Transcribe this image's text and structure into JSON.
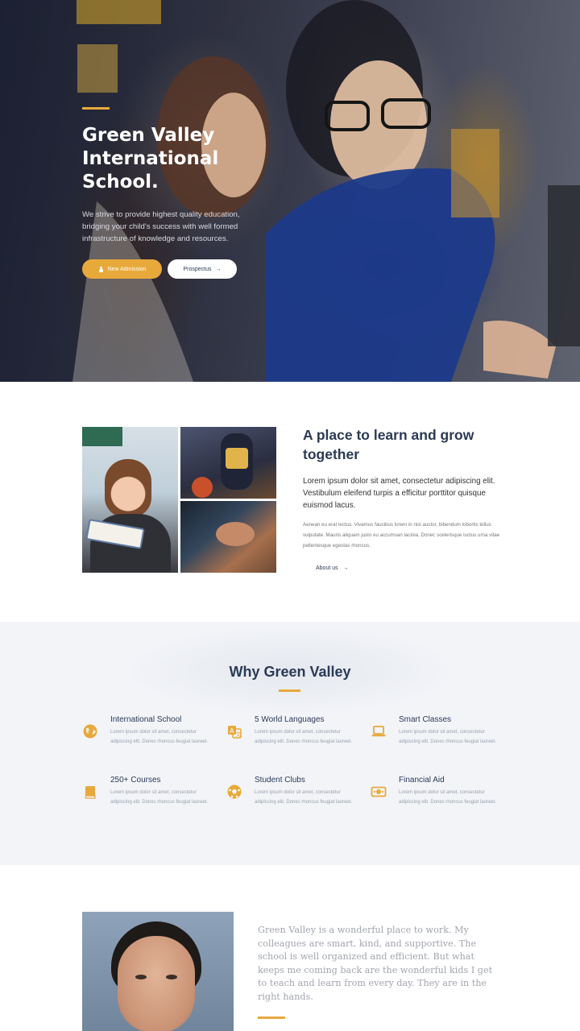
{
  "hero": {
    "title": "Green Valley International School.",
    "description": "We strive to provide highest quality education, bridging your child's success with well formed infrastructure of knowledge and resources.",
    "primary_button": "New Admission",
    "secondary_button": "Prospectus",
    "arrow": "→"
  },
  "about": {
    "title": "A place to learn and grow together",
    "lead": "Lorem ipsum dolor sit amet, consectetur adipiscing elit. Vestibulum eleifend turpis a efficitur porttitor quisque euismod lacus.",
    "body": "Aenean eu erat lectus. Vivamus faucibus lorem in nisl auctor, bibendum lobortis tellus vulputate. Mauris aliquam justo eu accumsan lacinia. Donec scelerisque luctus urna vitae pellentesque egestas rhoncus.",
    "link": "About us",
    "arrow": "→"
  },
  "why": {
    "title": "Why Green Valley",
    "features": [
      {
        "title": "International School",
        "desc": "Lorem ipsum dolor sit amet, consectetur adipiscing elit. Donec rhoncus feugiat laoreet.",
        "icon": "globe-icon"
      },
      {
        "title": "5 World Languages",
        "desc": "Lorem ipsum dolor sit amet, consectetur adipiscing elit. Donec rhoncus feugiat laoreet.",
        "icon": "translate-icon"
      },
      {
        "title": "Smart Classes",
        "desc": "Lorem ipsum dolor sit amet, consectetur adipiscing elit. Donec rhoncus feugiat laoreet.",
        "icon": "laptop-icon"
      },
      {
        "title": "250+ Courses",
        "desc": "Lorem ipsum dolor sit amet, consectetur adipiscing elit. Donec rhoncus feugiat laoreet.",
        "icon": "book-icon"
      },
      {
        "title": "Student Clubs",
        "desc": "Lorem ipsum dolor sit amet, consectetur adipiscing elit. Donec rhoncus feugiat laoreet.",
        "icon": "soccer-ball-icon"
      },
      {
        "title": "Financial Aid",
        "desc": "Lorem ipsum dolor sit amet, consectetur adipiscing elit. Donec rhoncus feugiat laoreet.",
        "icon": "banknote-icon"
      }
    ]
  },
  "testimonial": {
    "quote": "Green Valley is a wonderful place to work. My colleagues are smart, kind, and supportive. The school is well organized and efficient. But what keeps me coming back are the wonderful kids I get to teach and learn from every day. They are in the right hands."
  },
  "colors": {
    "accent": "#e8a93b",
    "navy": "#2b3a55",
    "section_bg": "#f2f4f8"
  }
}
